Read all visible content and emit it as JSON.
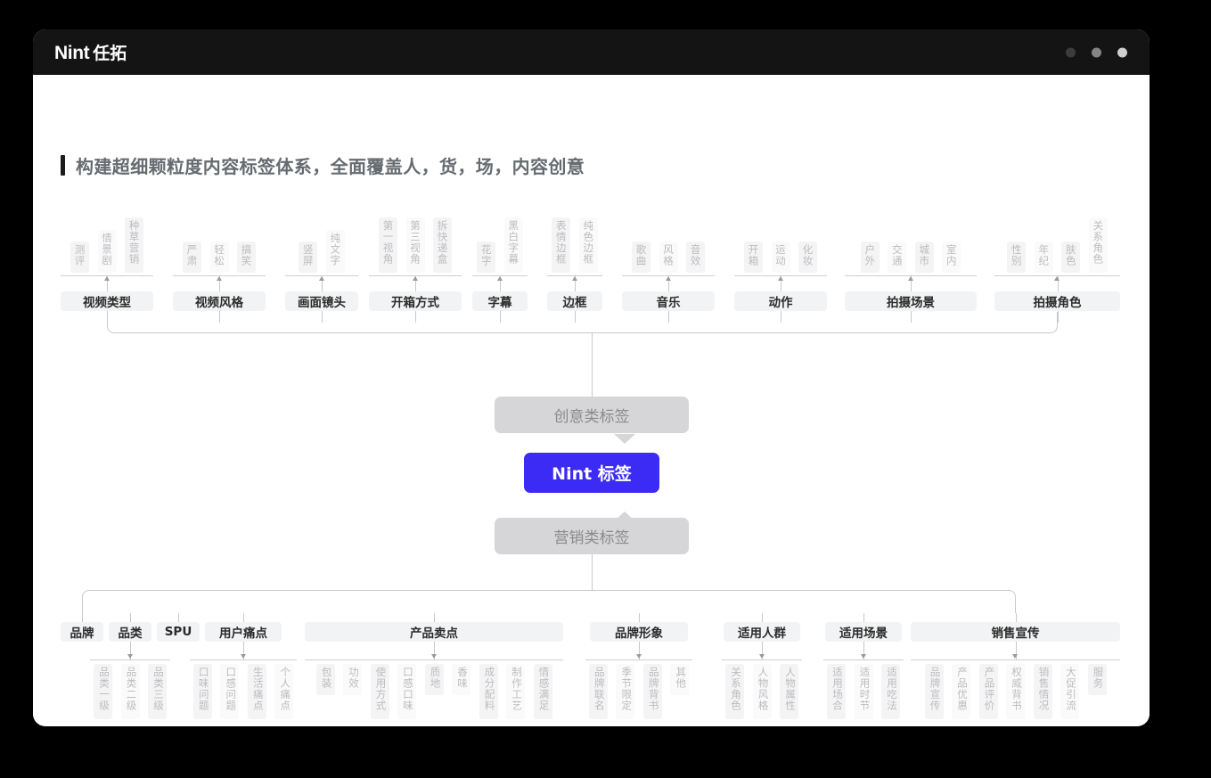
{
  "window": {
    "logo_primary": "Nint",
    "logo_secondary": "任拓",
    "dots": [
      "window-dot-1",
      "window-dot-2",
      "window-dot-3"
    ]
  },
  "page": {
    "title": "构建超细颗粒度内容标签体系，全面覆盖人，货，场，内容创意",
    "accent_color": "#3b2bf5",
    "chip_bg": "#f2f3f4",
    "tag_bg": "#f4f4f5",
    "tag_text_color": "#bcbcc0"
  },
  "center": {
    "top_label": "创意类标签",
    "core_label": "Nint 标签",
    "bottom_label": "营销类标签"
  },
  "creative_groups": [
    {
      "label": "视频类型",
      "tags": [
        "测评",
        "情景剧",
        "种草营销"
      ]
    },
    {
      "label": "视频风格",
      "tags": [
        "严肃",
        "轻松",
        "搞笑"
      ]
    },
    {
      "label": "画面镜头",
      "tags": [
        "竖屏",
        "纯文字"
      ]
    },
    {
      "label": "开箱方式",
      "tags": [
        "第一视角",
        "第三视角",
        "拆快递盒"
      ]
    },
    {
      "label": "字幕",
      "tags": [
        "花字",
        "黑白字幕"
      ]
    },
    {
      "label": "边框",
      "tags": [
        "表情边框",
        "纯色边框"
      ]
    },
    {
      "label": "音乐",
      "tags": [
        "歌曲",
        "风格",
        "音效"
      ]
    },
    {
      "label": "动作",
      "tags": [
        "开箱",
        "运动",
        "化妆"
      ]
    },
    {
      "label": "拍摄场景",
      "tags": [
        "户外",
        "交通",
        "城市",
        "室内"
      ]
    },
    {
      "label": "拍摄角色",
      "tags": [
        "性别",
        "年纪",
        "肤色",
        "关系角色"
      ]
    }
  ],
  "marketing_groups": [
    {
      "label": "品牌",
      "tags": []
    },
    {
      "label": "品类",
      "tags": [
        "品类一级",
        "品类二级",
        "品类三级"
      ]
    },
    {
      "label": "SPU",
      "tags": []
    },
    {
      "label": "用户痛点",
      "tags": [
        "口味问题",
        "口感问题",
        "生活痛点",
        "个人痛点"
      ]
    },
    {
      "label": "产品卖点",
      "tags": [
        "包装",
        "功效",
        "使用方式",
        "口感口味",
        "质地",
        "香味",
        "成分配料",
        "制作工艺",
        "情感满足"
      ]
    },
    {
      "label": "品牌形象",
      "tags": [
        "品牌联名",
        "季节限定",
        "品牌背书",
        "其他"
      ]
    },
    {
      "label": "适用人群",
      "tags": [
        "关系角色",
        "人物风格",
        "人物属性"
      ]
    },
    {
      "label": "适用场景",
      "tags": [
        "适用场合",
        "适用时节",
        "适用吃法"
      ]
    },
    {
      "label": "销售宣传",
      "tags": [
        "品牌宣传",
        "产品优惠",
        "产品评价",
        "权威背书",
        "销售情况",
        "大促引流",
        "服务"
      ]
    }
  ]
}
